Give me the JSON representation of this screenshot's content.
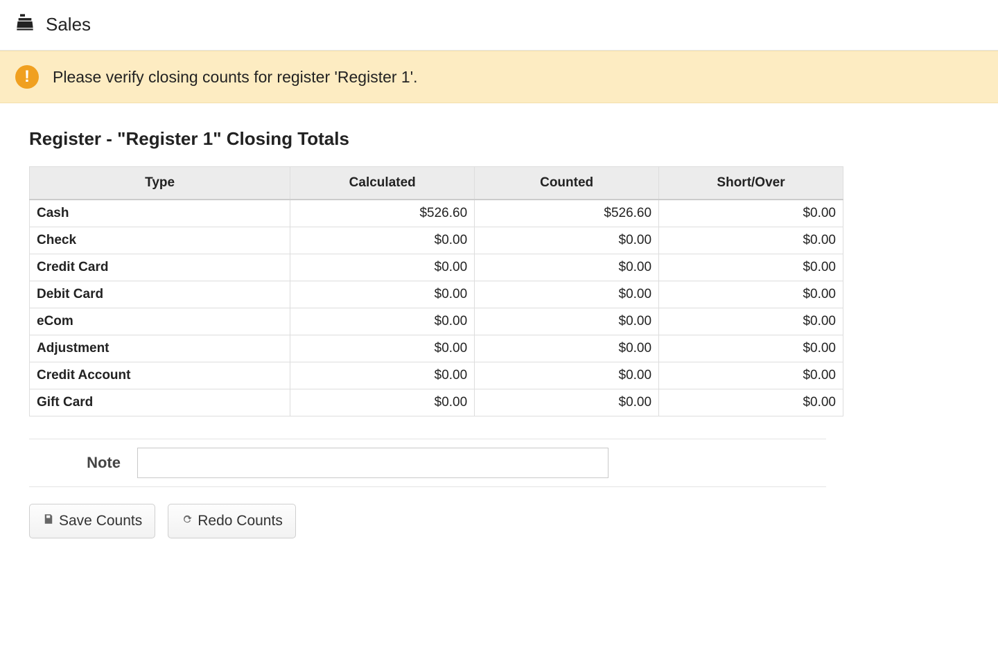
{
  "header": {
    "title": "Sales",
    "icon": "cash-register-icon"
  },
  "alert": {
    "icon": "warning-icon",
    "message": "Please verify closing counts for register 'Register 1'."
  },
  "main": {
    "heading": "Register - \"Register 1\" Closing Totals",
    "table": {
      "headers": {
        "type": "Type",
        "calculated": "Calculated",
        "counted": "Counted",
        "short_over": "Short/Over"
      },
      "rows": [
        {
          "type": "Cash",
          "calculated": "$526.60",
          "counted": "$526.60",
          "short_over": "$0.00"
        },
        {
          "type": "Check",
          "calculated": "$0.00",
          "counted": "$0.00",
          "short_over": "$0.00"
        },
        {
          "type": "Credit Card",
          "calculated": "$0.00",
          "counted": "$0.00",
          "short_over": "$0.00"
        },
        {
          "type": "Debit Card",
          "calculated": "$0.00",
          "counted": "$0.00",
          "short_over": "$0.00"
        },
        {
          "type": "eCom",
          "calculated": "$0.00",
          "counted": "$0.00",
          "short_over": "$0.00"
        },
        {
          "type": "Adjustment",
          "calculated": "$0.00",
          "counted": "$0.00",
          "short_over": "$0.00"
        },
        {
          "type": "Credit Account",
          "calculated": "$0.00",
          "counted": "$0.00",
          "short_over": "$0.00"
        },
        {
          "type": "Gift Card",
          "calculated": "$0.00",
          "counted": "$0.00",
          "short_over": "$0.00"
        }
      ]
    },
    "note": {
      "label": "Note",
      "value": "",
      "placeholder": ""
    },
    "buttons": {
      "save": {
        "label": "Save Counts",
        "icon": "save-icon"
      },
      "redo": {
        "label": "Redo Counts",
        "icon": "refresh-icon"
      }
    }
  }
}
